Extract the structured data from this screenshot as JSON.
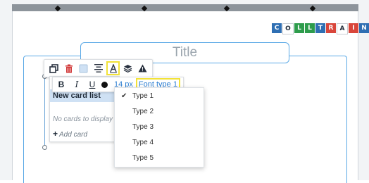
{
  "logo": {
    "letters": [
      "C",
      "O",
      "L",
      "L",
      "T",
      "R",
      "A",
      "I",
      "N"
    ],
    "colors": [
      "#2f6fb3",
      "#ffffff",
      "#2e9c4c",
      "#2e9c4c",
      "#2f6fb3",
      "#d9463b",
      "#ffffff",
      "#d9463b",
      "#2f6fb3"
    ],
    "text_colors": [
      "#ffffff",
      "#1f2a37",
      "#ffffff",
      "#ffffff",
      "#ffffff",
      "#ffffff",
      "#1f2a37",
      "#ffffff",
      "#ffffff"
    ]
  },
  "board": {
    "title": "Title"
  },
  "toolbar1": {
    "buttons": [
      "duplicate-icon",
      "delete-icon",
      "color-swatch-icon",
      "align-center-icon",
      "text-format-icon",
      "layers-icon",
      "warning-icon"
    ]
  },
  "toolbar2": {
    "bold": "B",
    "italic": "I",
    "underline": "U",
    "font_size": "14 px",
    "font_type": "Font type 1"
  },
  "card": {
    "header": "New card list",
    "empty_text": "No cards to display",
    "add_label": "Add card"
  },
  "dropdown": {
    "selected_index": 0,
    "items": [
      "Type 1",
      "Type 2",
      "Type 3",
      "Type 4",
      "Type 5"
    ]
  }
}
